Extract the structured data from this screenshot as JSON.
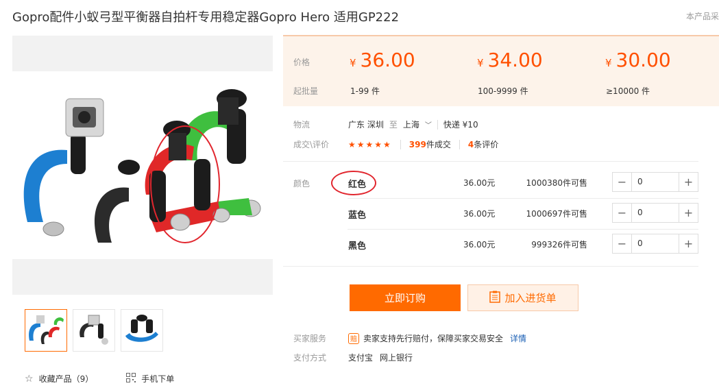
{
  "product": {
    "title": "Gopro配件小蚁弓型平衡器自拍杆专用稳定器Gopro Hero 适用GP222",
    "corner_text": "本产品采"
  },
  "price_box": {
    "price_label": "价格",
    "moq_label": "起批量",
    "currency": "¥",
    "tiers": [
      {
        "price": "36.00",
        "qty": "1-99 件"
      },
      {
        "price": "34.00",
        "qty": "100-9999 件"
      },
      {
        "price": "30.00",
        "qty": "≥10000 件"
      }
    ]
  },
  "logistics": {
    "label": "物流",
    "from": "广东 深圳",
    "to_word": "至",
    "to": "上海",
    "express": "快递 ¥10"
  },
  "deal": {
    "label": "成交\\评价",
    "stars": "★★★★★",
    "sold_count": "399",
    "sold_suffix": "件成交",
    "review_count": "4",
    "review_suffix": "条评价"
  },
  "sku": {
    "label": "颜色",
    "rows": [
      {
        "name": "红色",
        "price": "36.00元",
        "stock": "1000380件可售",
        "qty": "0"
      },
      {
        "name": "蓝色",
        "price": "36.00元",
        "stock": "1000697件可售",
        "qty": "0"
      },
      {
        "name": "黑色",
        "price": "36.00元",
        "stock": "999326件可售",
        "qty": "0"
      }
    ]
  },
  "actions": {
    "buy_now": "立即订购",
    "add_cart": "加入进货单"
  },
  "service": {
    "label": "买家服务",
    "badge": "赔",
    "text": "卖家支持先行赔付，保障买家交易安全",
    "link": "详情"
  },
  "payment": {
    "label": "支付方式",
    "methods": [
      "支付宝",
      "网上银行"
    ]
  },
  "bottom": {
    "favorite": "收藏产品（9）",
    "mobile": "手机下单"
  },
  "colors": {
    "accent": "#ff5000",
    "button": "#ff6a00",
    "highlight_circle": "#e1262e"
  }
}
